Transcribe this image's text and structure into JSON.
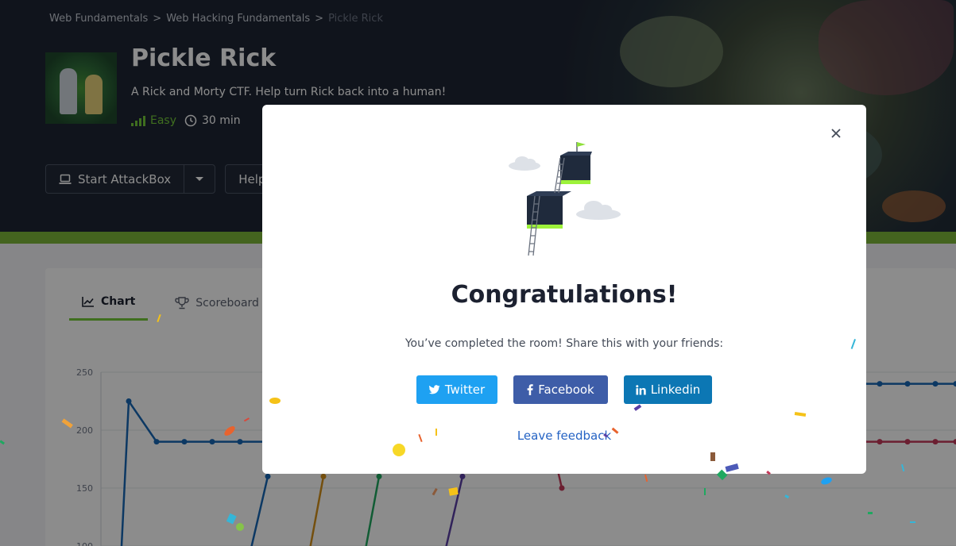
{
  "breadcrumb": {
    "items": [
      "Web Fundamentals",
      "Web Hacking Fundamentals"
    ],
    "current": "Pickle Rick",
    "separator": ">"
  },
  "room": {
    "title": "Pickle Rick",
    "description": "A Rick and Morty CTF. Help turn Rick back into a human!",
    "difficulty": "Easy",
    "duration": "30 min"
  },
  "actions": {
    "attackbox_label": "Start AttackBox",
    "help_label": "Help"
  },
  "tabs": [
    {
      "label": "Chart",
      "icon": "line-chart-icon",
      "active": true
    },
    {
      "label": "Scoreboard",
      "icon": "trophy-icon",
      "active": false
    }
  ],
  "chart_data": {
    "type": "line",
    "ylim": [
      100,
      250
    ],
    "yticks": [
      "250",
      "200",
      "150",
      "100"
    ],
    "series": [
      {
        "color": "#1767b5"
      },
      {
        "color": "#1767b5"
      },
      {
        "color": "#d4901a"
      },
      {
        "color": "#1fa860"
      },
      {
        "color": "#5a3fa5"
      },
      {
        "color": "#c43a5a"
      }
    ],
    "visible_levels": [
      190,
      160,
      240,
      190
    ]
  },
  "modal": {
    "title": "Congratulations!",
    "message": "You’ve completed the room! Share this with your friends:",
    "buttons": {
      "twitter": "Twitter",
      "facebook": "Facebook",
      "linkedin": "Linkedin"
    },
    "feedback_link": "Leave feedback"
  },
  "colors": {
    "accent_green": "#7db73a",
    "twitter": "#1ea1f2",
    "facebook": "#3e5da8",
    "linkedin": "#0c77b4",
    "link": "#2563c4"
  }
}
